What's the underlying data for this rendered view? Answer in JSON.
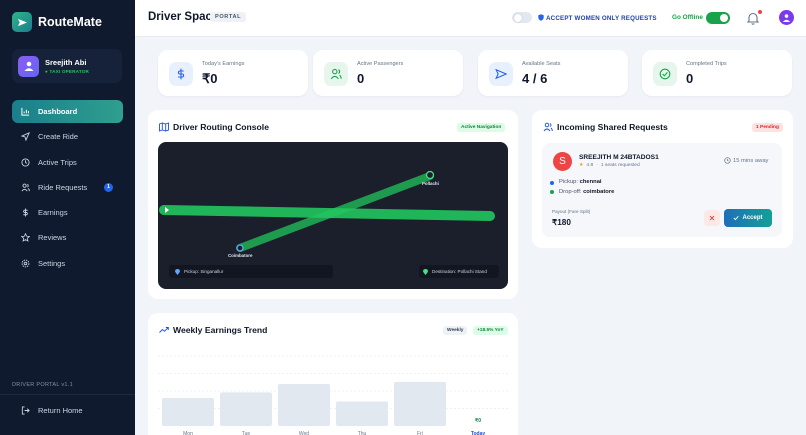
{
  "sidebar": {
    "brand": "RouteMate",
    "profile": {
      "name": "Sreejith Abi",
      "role": "TAXI OPERATOR"
    },
    "items": [
      {
        "label": "Dashboard",
        "icon": "bar-chart-icon",
        "active": true
      },
      {
        "label": "Create Ride",
        "icon": "send-icon"
      },
      {
        "label": "Active Trips",
        "icon": "clock-icon"
      },
      {
        "label": "Ride Requests",
        "icon": "users-icon",
        "badge": "1"
      },
      {
        "label": "Earnings",
        "icon": "dollar-icon"
      },
      {
        "label": "Reviews",
        "icon": "star-icon"
      },
      {
        "label": "Settings",
        "icon": "gear-icon"
      }
    ],
    "portal_version": "DRIVER PORTAL v1.1",
    "return_home": "Return Home"
  },
  "header": {
    "title": "Driver Space",
    "portal_tag": "PORTAL",
    "women_only_label": "ACCEPT WOMEN ONLY REQUESTS",
    "go_offline_label": "Go Offline"
  },
  "stats": [
    {
      "label": "Today's Earnings",
      "value": "₹0",
      "icon": "dollar-icon",
      "color": "#2563eb",
      "bg": "#e8f0fe"
    },
    {
      "label": "Active Passengers",
      "value": "0",
      "icon": "users-icon",
      "color": "#16a34a",
      "bg": "#e6f6ec"
    },
    {
      "label": "Available Seats",
      "value": "4 / 6",
      "icon": "send-icon",
      "color": "#2563eb",
      "bg": "#e8f0fe"
    },
    {
      "label": "Completed Trips",
      "value": "0",
      "icon": "check-circle-icon",
      "color": "#16a34a",
      "bg": "#e6f6ec"
    }
  ],
  "routing": {
    "title": "Driver Routing Console",
    "badge": "Active Navigation",
    "pickup": "Pickup: Singanallur",
    "destination": "Destination: Pollachi Stand",
    "label_coimbatore": "Coimbatore",
    "label_pollachi": "Pollachi"
  },
  "requests": {
    "title": "Incoming Shared Requests",
    "pending": "1 Pending",
    "item": {
      "initial": "S",
      "name": "SREEJITH M 24BTADOS1",
      "rating": "4.8",
      "seats": "1 seats requested",
      "eta": "15 mins away",
      "pickup_label": "Pickup:",
      "pickup": "chennai",
      "dropoff_label": "Drop-off:",
      "dropoff": "coimbatore",
      "payout_label": "Payout (Fare Split)",
      "payout": "₹180",
      "accept_label": "Accept"
    }
  },
  "trend": {
    "title": "Weekly Earnings Trend",
    "badge_period": "Weekly",
    "badge_change": "+18.5% YoY"
  },
  "chart_data": {
    "type": "bar",
    "categories": [
      "Mon",
      "Tue",
      "Wed",
      "Thu",
      "Fri",
      "Today"
    ],
    "values": [
      40,
      48,
      60,
      35,
      63,
      0
    ],
    "data_labels": [
      "",
      "",
      "",
      "",
      "",
      "₹0"
    ],
    "title": "Weekly Earnings Trend",
    "ylim": [
      0,
      100
    ],
    "grid": true,
    "colors": {
      "bar": "#e2e8f0",
      "today_label": "#15803d",
      "today_tick": "#1d4ed8"
    }
  }
}
